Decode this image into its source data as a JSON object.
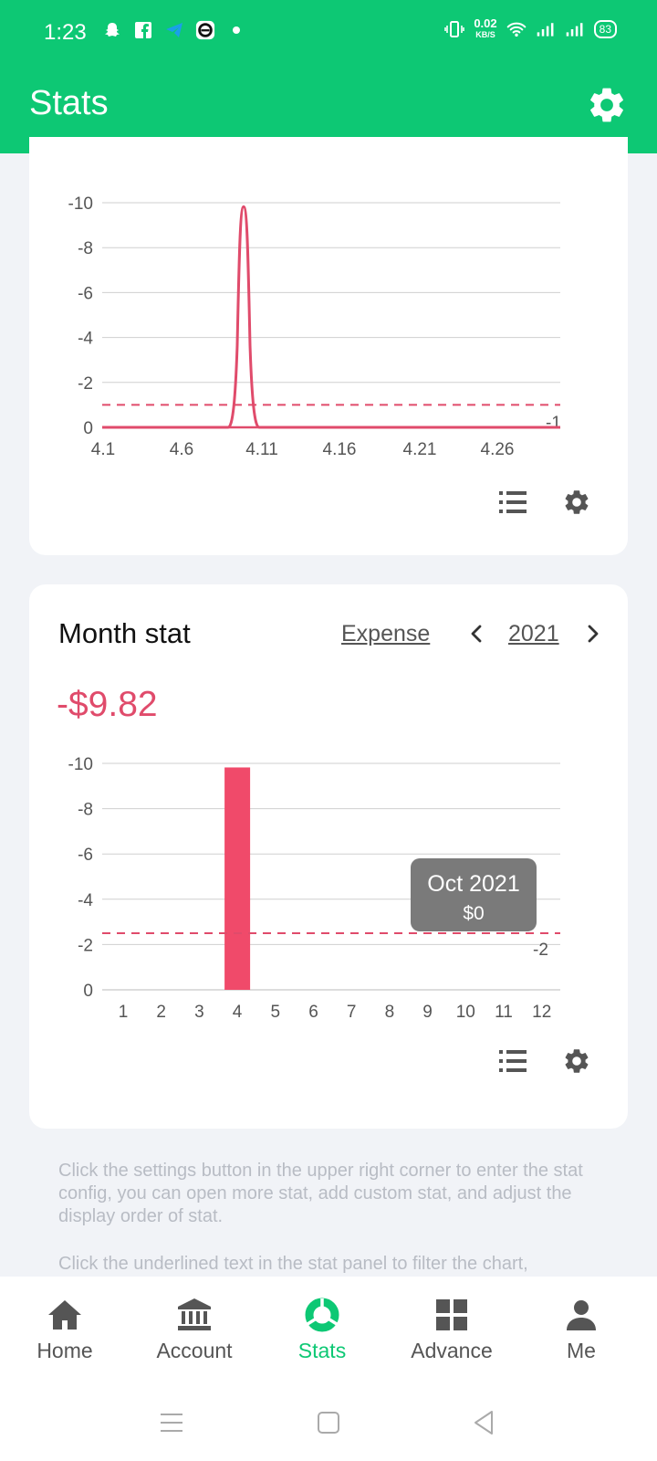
{
  "status": {
    "time": "1:23",
    "net_speed": "0.02",
    "net_unit": "KB/S",
    "battery": "83"
  },
  "app_bar": {
    "title": "Stats"
  },
  "top_chart": {
    "x_ticks": [
      "4.1",
      "4.6",
      "4.11",
      "4.16",
      "4.21",
      "4.26"
    ],
    "y_ticks": [
      "-10",
      "-8",
      "-6",
      "-4",
      "-2",
      "0"
    ],
    "avg_label": "-1"
  },
  "month_card": {
    "title": "Month stat",
    "filter": "Expense",
    "year": "2021",
    "total": "-$9.82",
    "tooltip_title": "Oct 2021",
    "tooltip_value": "$0",
    "avg_label": "-2",
    "y_ticks": [
      "-10",
      "-8",
      "-6",
      "-4",
      "-2",
      "0"
    ],
    "x_ticks": [
      "1",
      "2",
      "3",
      "4",
      "5",
      "6",
      "7",
      "8",
      "9",
      "10",
      "11",
      "12"
    ]
  },
  "chart_data": [
    {
      "type": "line",
      "x": [
        "4.1",
        "4.6",
        "4.11",
        "4.16",
        "4.21",
        "4.26"
      ],
      "series": [
        {
          "values": [
            0,
            0,
            9.82,
            0,
            0,
            0
          ]
        }
      ],
      "x_tick_labels": [
        "4.1",
        "4.6",
        "4.11",
        "4.16",
        "4.21",
        "4.26"
      ],
      "y_tick_labels": [
        "-10",
        "-8",
        "-6",
        "-4",
        "-2",
        "0"
      ],
      "ylim": [
        0,
        10
      ],
      "reference_line": {
        "value": 1,
        "label": "-1"
      },
      "grid": true
    },
    {
      "type": "bar",
      "categories": [
        "1",
        "2",
        "3",
        "4",
        "5",
        "6",
        "7",
        "8",
        "9",
        "10",
        "11",
        "12"
      ],
      "values": [
        0,
        0,
        0,
        9.82,
        0,
        0,
        0,
        0,
        0,
        0,
        0,
        0
      ],
      "y_tick_labels": [
        "-10",
        "-8",
        "-6",
        "-4",
        "-2",
        "0"
      ],
      "ylim": [
        0,
        10
      ],
      "reference_line": {
        "value": 2.5,
        "label": "-2"
      },
      "grid": true,
      "color": "#f04a6a"
    }
  ],
  "hints": [
    "Click the settings button in the upper right corner to enter the stat config, you can open more stat, add custom stat, and adjust the display order of stat.",
    "Click the underlined text in the stat panel to filter the chart,"
  ],
  "nav": [
    {
      "label": "Home",
      "icon": "home-icon"
    },
    {
      "label": "Account",
      "icon": "bank-icon"
    },
    {
      "label": "Stats",
      "icon": "stats-icon"
    },
    {
      "label": "Advance",
      "icon": "grid-icon"
    },
    {
      "label": "Me",
      "icon": "person-icon"
    }
  ],
  "colors": {
    "primary": "#0dc874",
    "expense": "#e04b6b",
    "bar": "#f04a6a"
  }
}
